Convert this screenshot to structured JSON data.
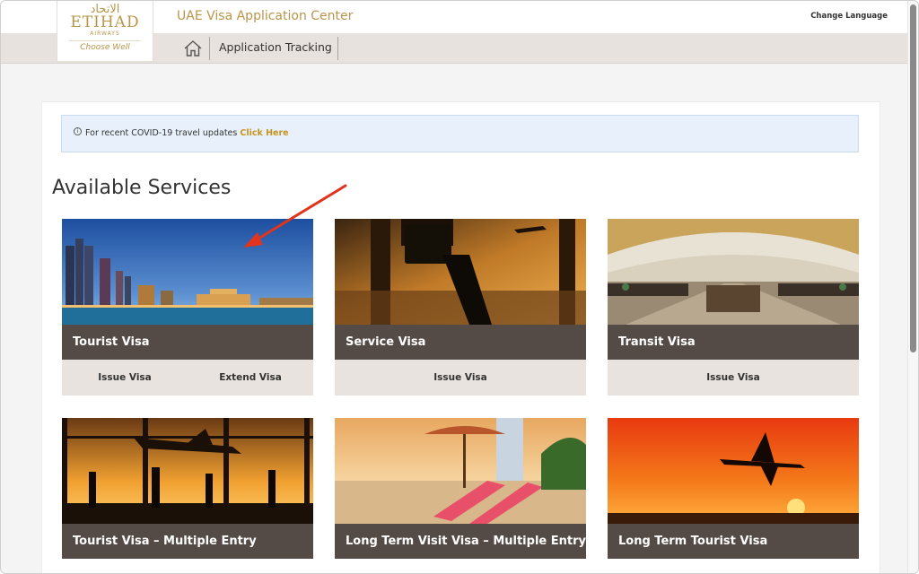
{
  "header": {
    "logo": {
      "arabic": "الاتحاد",
      "main": "ETIHAD",
      "sub": "AIRWAYS",
      "tagline": "Choose Well"
    },
    "app_title": "UAE Visa Application Center",
    "change_language": "Change Language",
    "nav": {
      "home_icon": "home-icon",
      "tracking": "Application Tracking"
    }
  },
  "alert": {
    "icon": "info-icon",
    "text": "For recent COVID-19 travel updates ",
    "link": "Click Here"
  },
  "section_title": "Available Services",
  "services": [
    {
      "title": "Tourist Visa",
      "actions": [
        "Issue Visa",
        "Extend Visa"
      ],
      "image": "city-skyline"
    },
    {
      "title": "Service Visa",
      "actions": [
        "Issue Visa"
      ],
      "image": "traveler-with-briefcase"
    },
    {
      "title": "Transit Visa",
      "actions": [
        "Issue Visa"
      ],
      "image": "airport-terminal"
    },
    {
      "title": "Tourist Visa – Multiple Entry",
      "actions": [],
      "image": "airport-window-silhouettes"
    },
    {
      "title": "Long Term Visit Visa – Multiple Entry",
      "actions": [],
      "image": "beach-loungers"
    },
    {
      "title": "Long Term Tourist Visa",
      "actions": [],
      "image": "plane-sunset"
    }
  ],
  "colors": {
    "gold": "#b8954a",
    "card_title_bg": "#554b46",
    "action_bg": "#e8e3de",
    "arrow": "#e0341e"
  }
}
